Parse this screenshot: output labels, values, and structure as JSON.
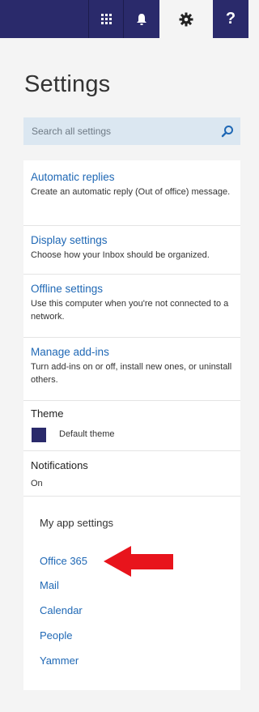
{
  "topbar": {
    "icons": [
      "apps-icon",
      "bell-icon",
      "gear-icon",
      "help-icon"
    ],
    "help_label": "?"
  },
  "page": {
    "title": "Settings"
  },
  "search": {
    "placeholder": "Search all settings"
  },
  "options": [
    {
      "label": "Automatic replies",
      "desc": "Create an automatic reply (Out of office) message."
    },
    {
      "label": "Display settings",
      "desc": "Choose how your Inbox should be organized."
    },
    {
      "label": "Offline settings",
      "desc": "Use this computer when you're not connected to a network."
    },
    {
      "label": "Manage add-ins",
      "desc": "Turn add-ins on or off, install new ones, or uninstall others."
    }
  ],
  "theme": {
    "label": "Theme",
    "value": "Default theme",
    "swatch_color": "#2a2a6b"
  },
  "notifications": {
    "label": "Notifications",
    "value": "On"
  },
  "my_app_settings": {
    "title": "My app settings",
    "items": [
      "Office 365",
      "Mail",
      "Calendar",
      "People",
      "Yammer"
    ]
  },
  "colors": {
    "brand": "#2a2a6b",
    "link": "#1f68b5",
    "arrow": "#e8141c"
  }
}
